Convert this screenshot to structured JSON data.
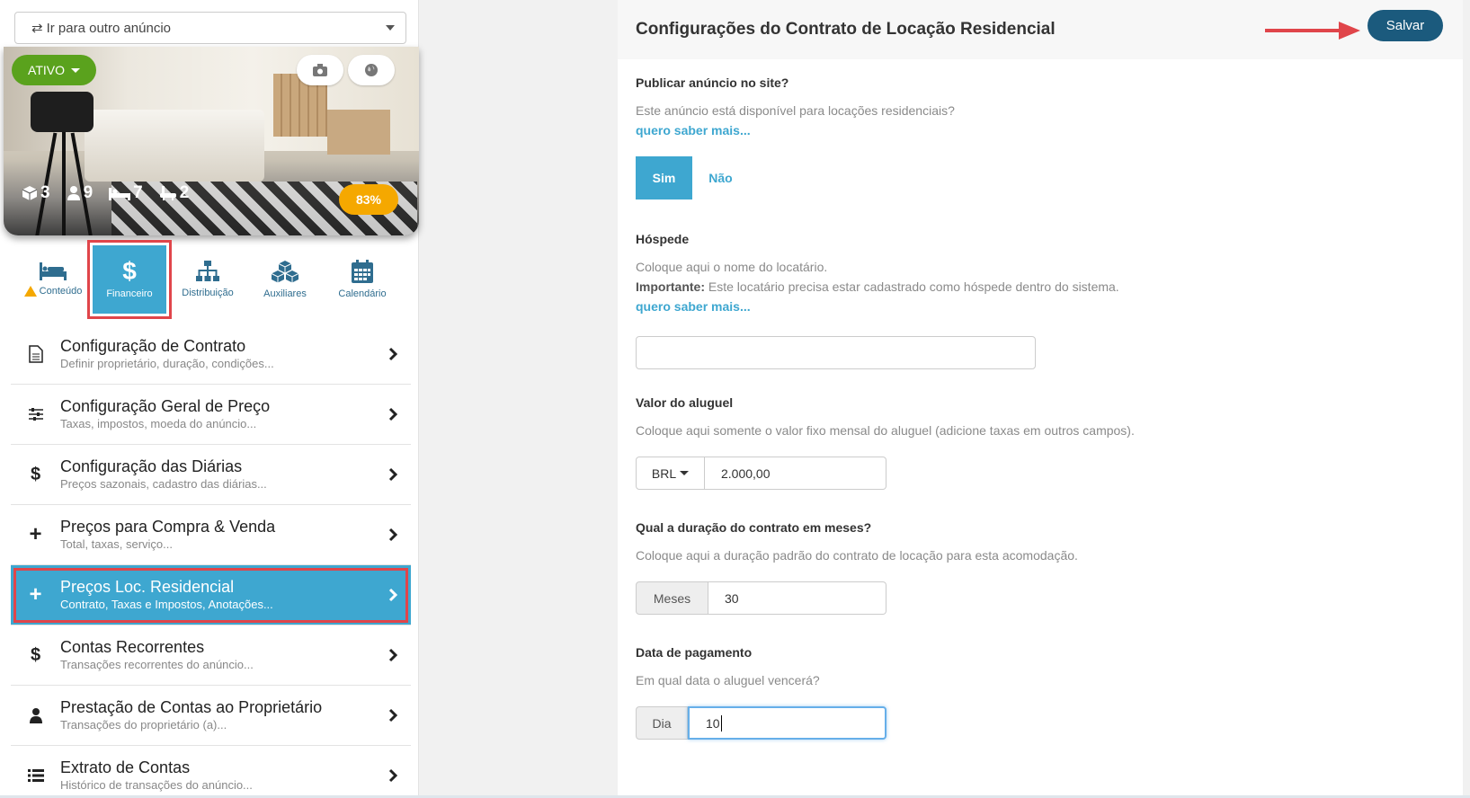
{
  "sidebar": {
    "goto_label": "Ir para outro anúncio",
    "status_label": "ATIVO",
    "stats": {
      "boxes": "3",
      "guests": "9",
      "beds": "7",
      "baths": "2"
    },
    "completion": "83%",
    "tabs": [
      {
        "label": "Conteúdo",
        "icon": "bed-icon"
      },
      {
        "label": "Financeiro",
        "icon": "dollar-icon"
      },
      {
        "label": "Distribuição",
        "icon": "sitemap-icon"
      },
      {
        "label": "Auxiliares",
        "icon": "cubes-icon"
      },
      {
        "label": "Calendário",
        "icon": "calendar-icon"
      }
    ],
    "menu": [
      {
        "title": "Configuração de Contrato",
        "subtitle": "Definir proprietário, duração, condições...",
        "icon": "document-icon"
      },
      {
        "title": "Configuração Geral de Preço",
        "subtitle": "Taxas, impostos, moeda do anúncio...",
        "icon": "sliders-icon"
      },
      {
        "title": "Configuração das Diárias",
        "subtitle": "Preços sazonais, cadastro das diárias...",
        "icon": "dollar-icon"
      },
      {
        "title": "Preços para Compra & Venda",
        "subtitle": "Total, taxas, serviço...",
        "icon": "plus-icon"
      },
      {
        "title": "Preços Loc. Residencial",
        "subtitle": "Contrato, Taxas e Impostos, Anotações...",
        "icon": "plus-icon"
      },
      {
        "title": "Contas Recorrentes",
        "subtitle": "Transações recorrentes do anúncio...",
        "icon": "dollar-icon"
      },
      {
        "title": "Prestação de Contas ao Proprietário",
        "subtitle": "Transações do proprietário (a)...",
        "icon": "user-icon"
      },
      {
        "title": "Extrato de Contas",
        "subtitle": "Histórico de transações do anúncio...",
        "icon": "list-icon"
      }
    ]
  },
  "panel": {
    "title": "Configurações do Contrato de Locação Residencial",
    "save_label": "Salvar",
    "publish": {
      "question": "Publicar anúncio no site?",
      "description": "Este anúncio está disponível para locações residenciais?",
      "more": "quero saber mais...",
      "yes": "Sim",
      "no": "Não"
    },
    "guest": {
      "question": "Hóspede",
      "description": "Coloque aqui o nome do locatário.",
      "important_label": "Importante:",
      "important_text": " Este locatário precisa estar cadastrado como hóspede dentro do sistema.",
      "more": "quero saber mais...",
      "value": ""
    },
    "rent": {
      "question": "Valor do aluguel",
      "description": "Coloque aqui somente o valor fixo mensal do aluguel (adicione taxas em outros campos).",
      "currency": "BRL",
      "value": "2.000,00"
    },
    "duration": {
      "question": "Qual a duração do contrato em meses?",
      "description": "Coloque aqui a duração padrão do contrato de locação para esta acomodação.",
      "unit": "Meses",
      "value": "30"
    },
    "payment": {
      "question": "Data de pagamento",
      "description": "Em qual data o aluguel vencerá?",
      "unit": "Dia",
      "value": "10"
    }
  },
  "colors": {
    "accent": "#3ea7d0",
    "primary_dark": "#1b5a7d",
    "active_green": "#5aa21d",
    "completion_orange": "#f5a800",
    "highlight_red": "#e0454a"
  }
}
